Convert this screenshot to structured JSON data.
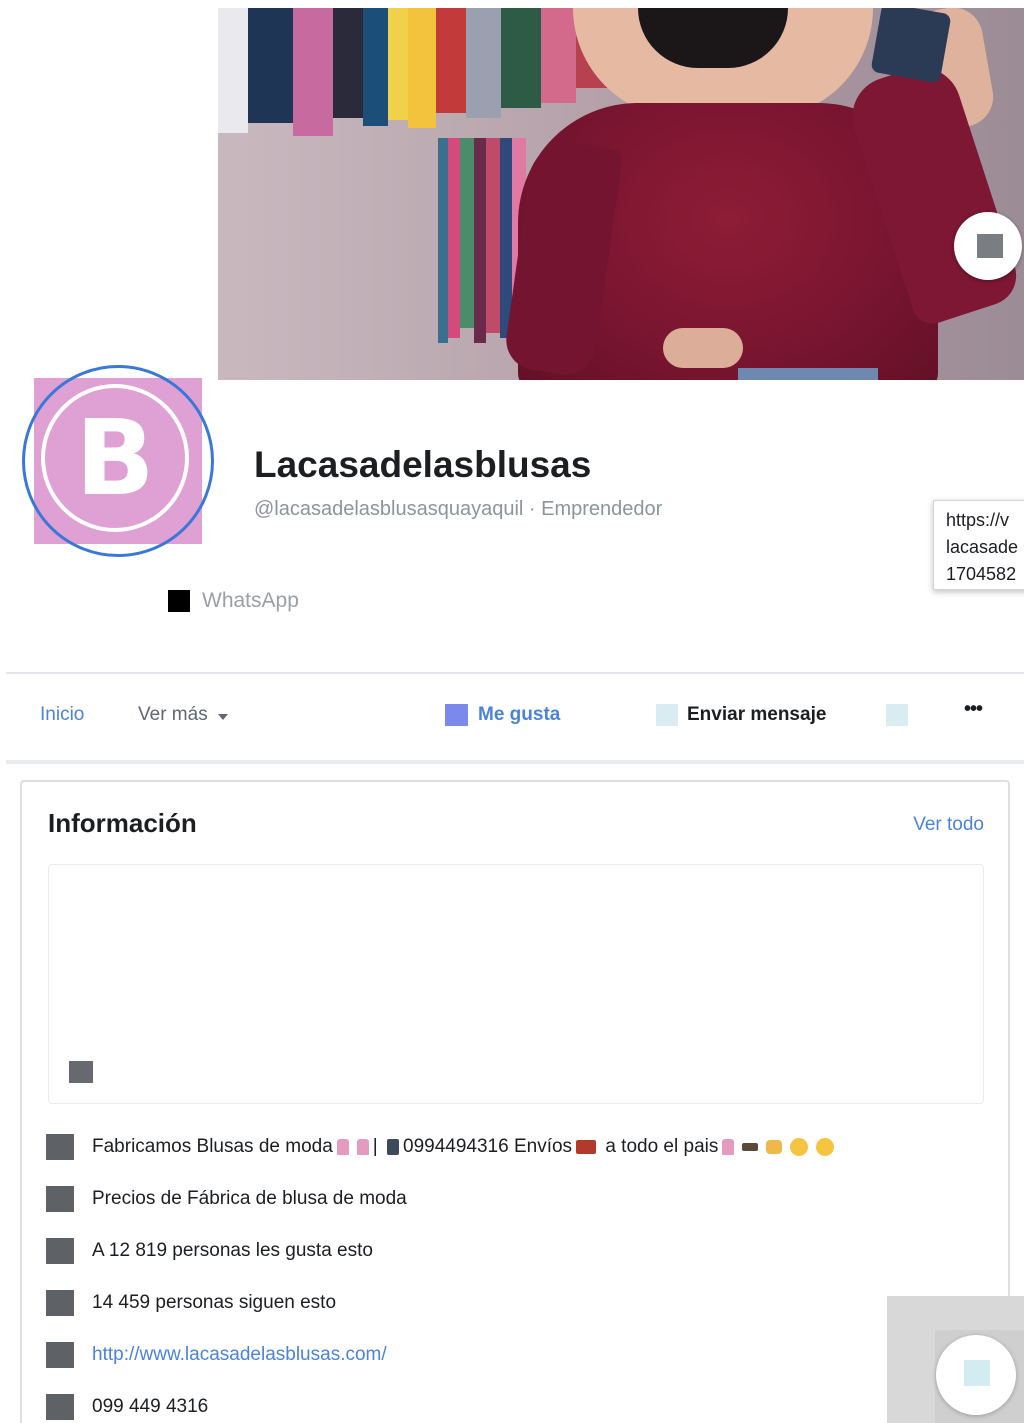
{
  "page": {
    "name": "Lacasadelasblusas",
    "handle_line": "@lacasadelasblusasquayaquil · Emprendedor",
    "avatar_letter": "B",
    "whatsapp_label": "WhatsApp",
    "tooltip_lines": [
      "https://v",
      "lacasade",
      "1704582"
    ]
  },
  "tabs": {
    "home_label": "Inicio",
    "more_label": "Ver más",
    "like_label": "Me gusta",
    "message_label": "Enviar mensaje",
    "overflow_label": "•••"
  },
  "info_card": {
    "title": "Información",
    "see_all_label": "Ver todo",
    "rows": [
      {
        "text": "Fabricamos Blusas de moda",
        "text2": "| ",
        "text3": "0994494316 Envíos",
        "text4": "a todo el pais"
      },
      {
        "text": "Precios de Fábrica de blusa de moda"
      },
      {
        "text": "A 12 819 personas les gusta esto"
      },
      {
        "text": "14 459 personas siguen esto"
      },
      {
        "text": "http://www.lacasadelasblusas.com/"
      },
      {
        "text": "099 449 4316"
      }
    ]
  },
  "colors": {
    "link_blue": "#4b83d9",
    "avatar_pink": "#dfa0d4",
    "avatar_ring": "#3a78d8",
    "blouse_burgundy": "#7a1530"
  },
  "icons": {
    "cover_action": "camera-icon",
    "like": "thumbs-up-icon",
    "message": "messenger-icon",
    "chat": "chat-icon"
  }
}
